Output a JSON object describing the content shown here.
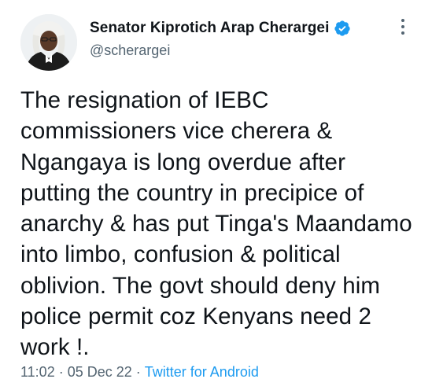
{
  "author": {
    "display_name": "Senator Kiprotich Arap Cherargei",
    "handle": "@scherargei",
    "verified": true,
    "verified_color": "#1d9bf0",
    "avatar_icon": "profile-photo-judge-wig"
  },
  "tweet": {
    "text": "The resignation of IEBC\ncommissioners vice cherera &\nNgangaya is long overdue after\nputting the country in precipice of\nanarchy & has put Tinga's Maandamo\ninto limbo, confusion & political\noblivion. The govt should deny him\npolice permit coz Kenyans need 2\nwork !."
  },
  "meta": {
    "time": "11:02",
    "date": "05 Dec 22",
    "separator": "·",
    "source": "Twitter for Android",
    "source_color": "#1d9bf0"
  },
  "icons": {
    "more": "more-vertical-icon",
    "verified": "verified-badge-icon"
  }
}
